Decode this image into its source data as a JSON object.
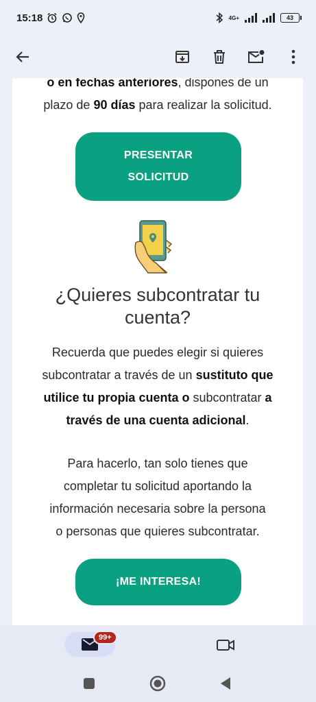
{
  "status_bar": {
    "time": "15:18",
    "network": "4G+",
    "battery": "43"
  },
  "app_bar": {
    "back_icon": "arrow-back-icon",
    "actions": [
      "archive-icon",
      "delete-icon",
      "mark-unread-icon",
      "more-vert-icon"
    ]
  },
  "email": {
    "para1_line1_bold": "o en fechas anteriores",
    "para1_line1_rest": ", dispones de un",
    "para1_line2_pre": "plazo de ",
    "para1_line2_bold": "90 días",
    "para1_line2_post": " para realizar la solicitud.",
    "button_presentar_line1": "PRESENTAR",
    "button_presentar_line2": "SOLICITUD",
    "illustration": "phone-in-hand-icon",
    "heading_line1": "¿Quieres subcontratar tu",
    "heading_line2": "cuenta?",
    "para2_l1": "Recuerda que puedes elegir si quieres",
    "para2_l2_pre": "subcontratar a través de un ",
    "para2_l2_bold": "sustituto que",
    "para2_l3_bold": "utilice tu propia cuenta o",
    "para2_l3_mid": " subcontratar ",
    "para2_l3_bold2": "a",
    "para2_l4_bold": "través de una cuenta adicional",
    "para2_l4_post": ".",
    "para3_l1": "Para hacerlo, tan solo tienes que",
    "para3_l2": "completar tu solicitud aportando la",
    "para3_l3": "información necesaria sobre la persona",
    "para3_l4": "o personas que quieres subcontratar.",
    "button_interesa": "¡ME INTERESA!"
  },
  "bottom_nav": {
    "mail_icon": "mail-icon",
    "badge": "99+",
    "video_icon": "video-camera-icon"
  },
  "system_nav": [
    "recents-square-icon",
    "home-circle-icon",
    "back-triangle-icon"
  ],
  "colors": {
    "accent_green": "#0aa082",
    "badge_red": "#b3261e",
    "chrome_bg": "#eef0f9"
  }
}
